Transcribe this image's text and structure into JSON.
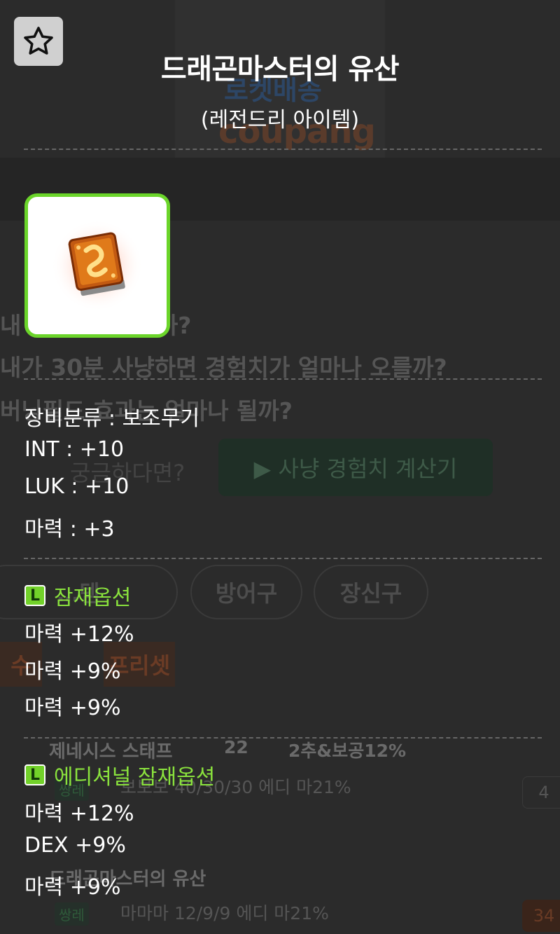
{
  "background": {
    "ad_text_1": "로켓배송",
    "ad_text_2": "coupang",
    "question_1": "내 ... 는 어디일까?",
    "question_2": "내가 30분 사냥하면 경험치가 얼마나 오를까?",
    "question_3": "버닝필드 효과는 얼마나 될까?",
    "curious_text": "궁금하다면?",
    "calc_button": "▶ 사냥 경험치 계산기",
    "categories": [
      "…템",
      "방어구",
      "장신구"
    ],
    "tag_orange": "수",
    "preset_tag": "프리셋",
    "listing_1": {
      "name": "제네시스 스태프",
      "stars": "22",
      "extra": "2추&보공12%",
      "grade": "쌍레",
      "options": "보보보 40/30/30 에디 마21%",
      "price": "4"
    },
    "listing_2": {
      "name": "드래곤마스터의 유산",
      "grade": "쌍레",
      "options": "마마마 12/9/9 에디 마21%",
      "price": "34"
    }
  },
  "tooltip": {
    "title": "드래곤마스터의 유산",
    "rarity": "(레전드리 아이템)",
    "item_icon": "dragon-master-book-icon",
    "stats": [
      "장비분류 : 보조무기",
      "INT :  +10",
      "LUK :  +10",
      "마력 :  +3"
    ],
    "potential": {
      "badge": "L",
      "title": "잠재옵션",
      "lines": [
        "마력 +12%",
        "마력 +9%",
        "마력 +9%"
      ]
    },
    "additional_potential": {
      "badge": "L",
      "title": "에디셔널 잠재옵션",
      "lines": [
        "마력 +12%",
        "DEX +9%",
        "마력 +9%"
      ]
    }
  },
  "colors": {
    "legendary_green": "#72d12a",
    "section_title_green": "#8ae23d",
    "overlay_bg": "#2b2b2b"
  }
}
